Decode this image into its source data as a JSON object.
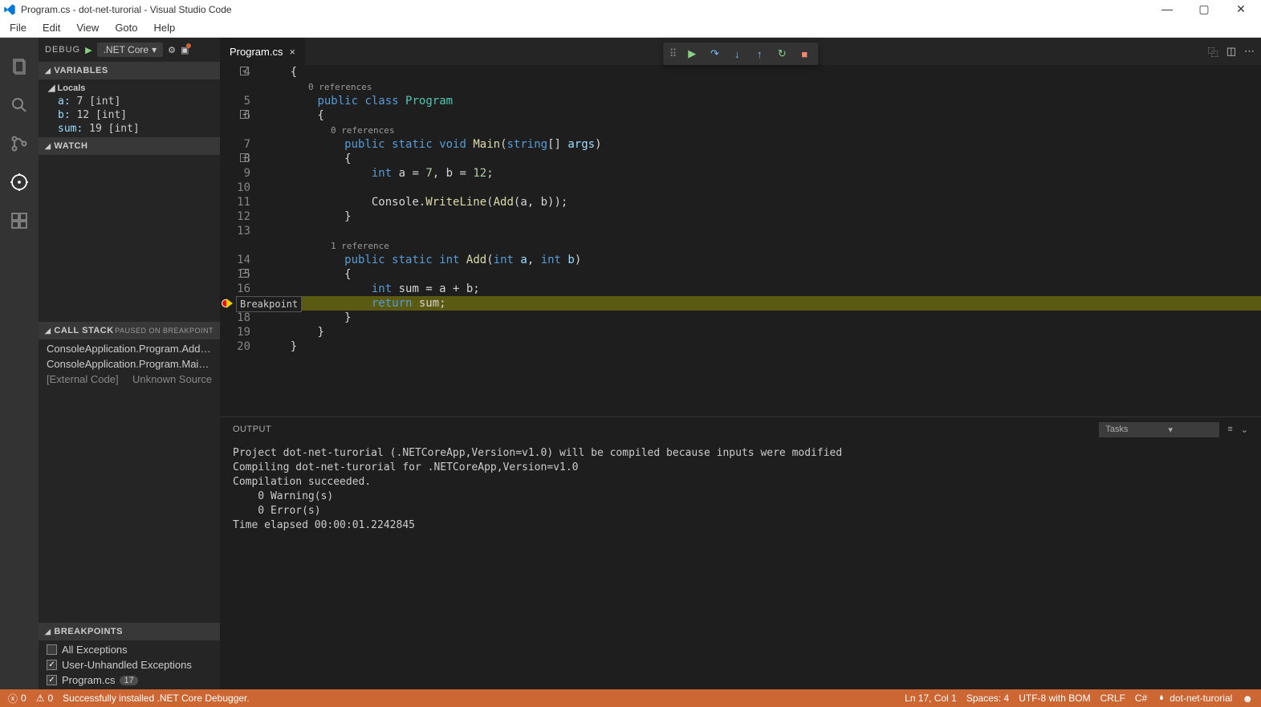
{
  "titlebar": {
    "title": "Program.cs - dot-net-turorial - Visual Studio Code"
  },
  "menubar": {
    "items": [
      "File",
      "Edit",
      "View",
      "Goto",
      "Help"
    ]
  },
  "debugHeader": {
    "label": "DEBUG",
    "config": ".NET Core"
  },
  "tabs": {
    "active": "Program.cs"
  },
  "variables": {
    "title": "VARIABLES",
    "group": "Locals",
    "items": [
      {
        "name": "a:",
        "value": "7 [int]"
      },
      {
        "name": "b:",
        "value": "12 [int]"
      },
      {
        "name": "sum:",
        "value": "19 [int]"
      }
    ]
  },
  "watch": {
    "title": "WATCH"
  },
  "callstack": {
    "title": "CALL STACK",
    "status": "PAUSED ON BREAKPOINT",
    "frames": [
      "ConsoleApplication.Program.Add(in...",
      "ConsoleApplication.Program.Main(s..."
    ],
    "external": "[External Code]",
    "unknown": "Unknown Source"
  },
  "breakpoints": {
    "title": "BREAKPOINTS",
    "items": [
      {
        "label": "All Exceptions",
        "checked": false
      },
      {
        "label": "User-Unhandled Exceptions",
        "checked": true
      },
      {
        "label": "Program.cs",
        "checked": true,
        "badge": "17"
      }
    ]
  },
  "codelens": {
    "ref0a": "0 references",
    "ref0b": "0 references",
    "ref1": "1 reference"
  },
  "breakpointLabel": "Breakpoint",
  "code": {
    "lines": [
      {
        "n": 4,
        "indent": 1,
        "tokens": [
          [
            "pl",
            "{"
          ]
        ]
      },
      {
        "n": 5,
        "indent": 2,
        "tokens": [
          [
            "kw",
            "public"
          ],
          [
            "pl",
            " "
          ],
          [
            "kw",
            "class"
          ],
          [
            "pl",
            " "
          ],
          [
            "type",
            "Program"
          ]
        ]
      },
      {
        "n": 6,
        "indent": 2,
        "tokens": [
          [
            "pl",
            "{"
          ]
        ]
      },
      {
        "n": 7,
        "indent": 3,
        "tokens": [
          [
            "kw",
            "public"
          ],
          [
            "pl",
            " "
          ],
          [
            "kw",
            "static"
          ],
          [
            "pl",
            " "
          ],
          [
            "kw",
            "void"
          ],
          [
            "pl",
            " "
          ],
          [
            "fn",
            "Main"
          ],
          [
            "pl",
            "("
          ],
          [
            "kw",
            "string"
          ],
          [
            "pl",
            "[] "
          ],
          [
            "vr",
            "args"
          ],
          [
            "pl",
            ")"
          ]
        ]
      },
      {
        "n": 8,
        "indent": 3,
        "tokens": [
          [
            "pl",
            "{"
          ]
        ]
      },
      {
        "n": 9,
        "indent": 4,
        "tokens": [
          [
            "kw",
            "int"
          ],
          [
            "pl",
            " a = "
          ],
          [
            "num",
            "7"
          ],
          [
            "pl",
            ", b = "
          ],
          [
            "num",
            "12"
          ],
          [
            "pl",
            ";"
          ]
        ]
      },
      {
        "n": 10,
        "indent": 4,
        "tokens": []
      },
      {
        "n": 11,
        "indent": 4,
        "tokens": [
          [
            "pl",
            "Console."
          ],
          [
            "fn",
            "WriteLine"
          ],
          [
            "pl",
            "("
          ],
          [
            "fn",
            "Add"
          ],
          [
            "pl",
            "(a, b));"
          ]
        ]
      },
      {
        "n": 12,
        "indent": 3,
        "tokens": [
          [
            "pl",
            "}"
          ]
        ]
      },
      {
        "n": 13,
        "indent": 3,
        "tokens": []
      },
      {
        "n": 14,
        "indent": 3,
        "tokens": [
          [
            "kw",
            "public"
          ],
          [
            "pl",
            " "
          ],
          [
            "kw",
            "static"
          ],
          [
            "pl",
            " "
          ],
          [
            "kw",
            "int"
          ],
          [
            "pl",
            " "
          ],
          [
            "fn",
            "Add"
          ],
          [
            "pl",
            "("
          ],
          [
            "kw",
            "int"
          ],
          [
            "pl",
            " "
          ],
          [
            "vr",
            "a"
          ],
          [
            "pl",
            ", "
          ],
          [
            "kw",
            "int"
          ],
          [
            "pl",
            " "
          ],
          [
            "vr",
            "b"
          ],
          [
            "pl",
            ")"
          ]
        ]
      },
      {
        "n": 15,
        "indent": 3,
        "tokens": [
          [
            "pl",
            "{"
          ]
        ]
      },
      {
        "n": 16,
        "indent": 4,
        "tokens": [
          [
            "kw",
            "int"
          ],
          [
            "pl",
            " sum = a + b;"
          ]
        ]
      },
      {
        "n": 17,
        "indent": 4,
        "hl": true,
        "tokens": [
          [
            "kw",
            "return"
          ],
          [
            "pl",
            " sum;"
          ]
        ]
      },
      {
        "n": 18,
        "indent": 3,
        "tokens": [
          [
            "pl",
            "}"
          ]
        ]
      },
      {
        "n": 19,
        "indent": 2,
        "tokens": [
          [
            "pl",
            "}"
          ]
        ]
      },
      {
        "n": 20,
        "indent": 1,
        "tokens": [
          [
            "pl",
            "}"
          ]
        ]
      }
    ]
  },
  "output": {
    "title": "OUTPUT",
    "dropdown": "Tasks",
    "lines": [
      "Project dot-net-turorial (.NETCoreApp,Version=v1.0) will be compiled because inputs were modified",
      "Compiling dot-net-turorial for .NETCoreApp,Version=v1.0",
      "Compilation succeeded.",
      "    0 Warning(s)",
      "    0 Error(s)",
      "Time elapsed 00:00:01.2242845"
    ]
  },
  "statusbar": {
    "errors": "0",
    "warnings": "0",
    "msg": "Successfully installed .NET Core Debugger.",
    "position": "Ln 17, Col 1",
    "spaces": "Spaces: 4",
    "encoding": "UTF-8 with BOM",
    "eol": "CRLF",
    "lang": "C#",
    "project": "dot-net-turorial"
  }
}
